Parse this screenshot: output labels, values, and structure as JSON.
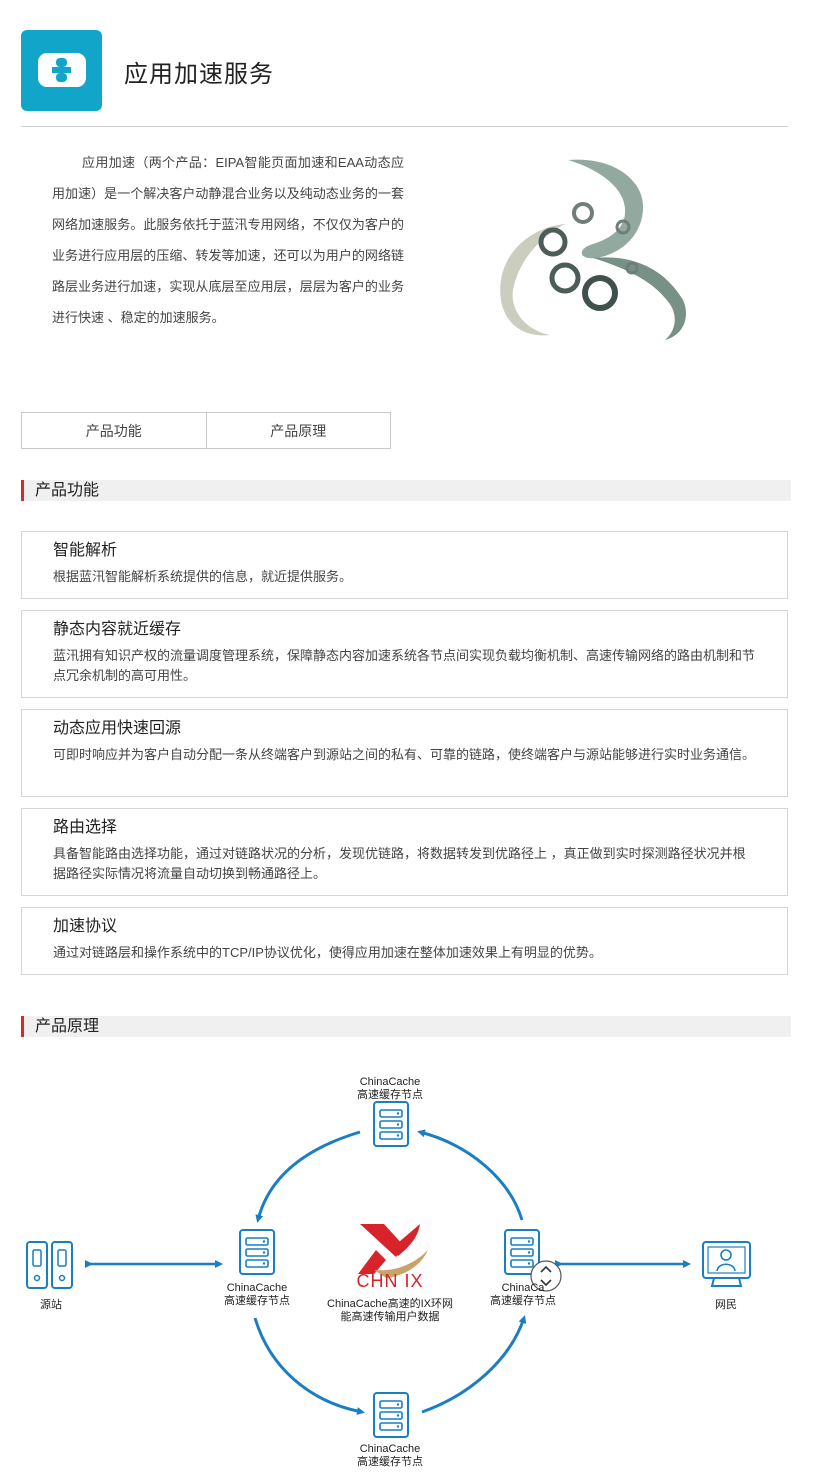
{
  "header": {
    "title": "应用加速服务"
  },
  "intro": {
    "text": "应用加速（两个产品：EIPA智能页面加速和EAA动态应用加速）是一个解决客户动静混合业务以及纯动态业务的一套网络加速服务。此服务依托于蓝汛专用网络，不仅仅为客户的业务进行应用层的压缩、转发等加速，还可以为用户的网络链路层业务进行加速，实现从底层至应用层，层层为客户的业务进行快速 、稳定的加速服务。"
  },
  "tabs": [
    {
      "label": "产品功能"
    },
    {
      "label": "产品原理"
    }
  ],
  "sections": {
    "features_title": "产品功能",
    "principle_title": "产品原理"
  },
  "features": [
    {
      "title": "智能解析",
      "desc": "根据蓝汛智能解析系统提供的信息，就近提供服务。"
    },
    {
      "title": "静态内容就近缓存",
      "desc": "蓝汛拥有知识产权的流量调度管理系统，保障静态内容加速系统各节点间实现负载均衡机制、高速传输网络的路由机制和节点冗余机制的高可用性。"
    },
    {
      "title": "动态应用快速回源",
      "desc": "可即时响应并为客户自动分配一条从终端客户到源站之间的私有、可靠的链路，使终端客户与源站能够进行实时业务通信。"
    },
    {
      "title": "路由选择",
      "desc": "具备智能路由选择功能，通过对链路状况的分析，发现优链路，将数据转发到优路径上 ，真正做到实时探测路径状况并根据路径实际情况将流量自动切换到畅通路径上。"
    },
    {
      "title": "加速协议",
      "desc": "通过对链路层和操作系统中的TCP/IP协议优化，使得应用加速在整体加速效果上有明显的优势。"
    }
  ],
  "diagram": {
    "node_top_1": "ChinaCache",
    "node_top_2": "高速缓存节点",
    "node_left_1": "ChinaCache",
    "node_left_2": "高速缓存节点",
    "node_right_1": "ChinaCa",
    "node_right_2": "高速缓存节点",
    "node_bottom_1": "ChinaCache",
    "node_bottom_2": "高速缓存节点",
    "source_label": "源站",
    "user_label": "网民",
    "center_brand": "CHN IX",
    "center_desc_1": "ChinaCache高速的IX环网",
    "center_desc_2": "能高速传输用户数据"
  },
  "colors": {
    "accent": "#11a5c9",
    "section_bar": "#d52a2a",
    "arrow": "#1a7fc2",
    "brand_red": "#d8232a"
  }
}
